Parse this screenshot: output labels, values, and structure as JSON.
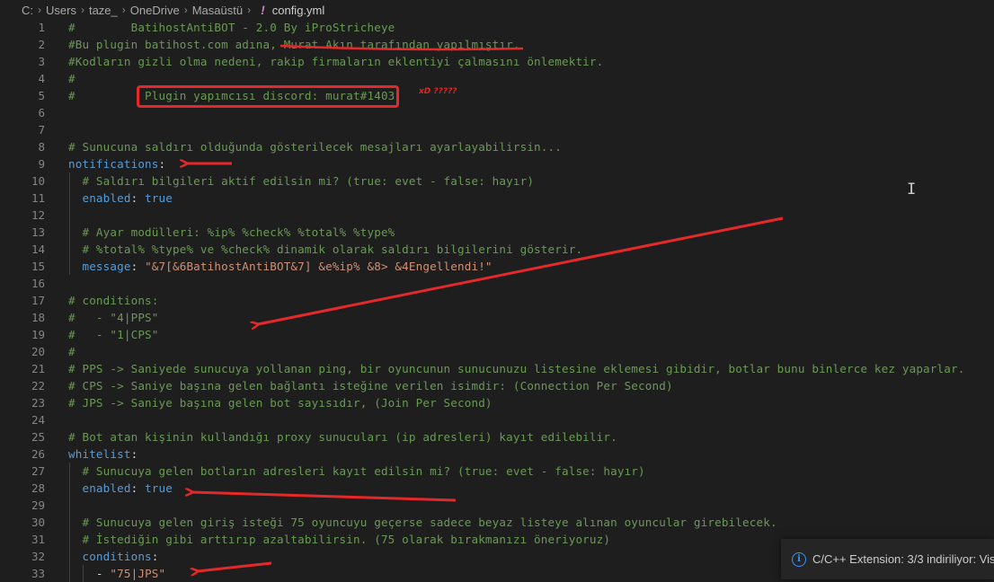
{
  "breadcrumb": {
    "items": [
      "C:",
      "Users",
      "taze_",
      "OneDrive",
      "Masaüstü"
    ],
    "file_icon": "!",
    "file": "config.yml"
  },
  "editor": {
    "lines": [
      {
        "n": "1",
        "t": [
          [
            "c",
            "#        BatihostAntiBOT - 2.0 By iProStricheye"
          ]
        ]
      },
      {
        "n": "2",
        "t": [
          [
            "c",
            "#Bu plugin batihost.com adına, Murat Akın tarafından yapılmıştır."
          ]
        ]
      },
      {
        "n": "3",
        "t": [
          [
            "c",
            "#Kodların gizli olma nedeni, rakip firmaların eklentiyi çalmasını önlemektir."
          ]
        ]
      },
      {
        "n": "4",
        "t": [
          [
            "c",
            "#"
          ]
        ]
      },
      {
        "n": "5",
        "t": [
          [
            "c",
            "#          Plugin yapımcısı discord: murat#1403"
          ]
        ]
      },
      {
        "n": "6",
        "t": []
      },
      {
        "n": "7",
        "t": []
      },
      {
        "n": "8",
        "t": [
          [
            "c",
            "# Sunucuna saldırı olduğunda gösterilecek mesajları ayarlayabilirsin..."
          ]
        ]
      },
      {
        "n": "9",
        "t": [
          [
            "k",
            "notifications"
          ],
          [
            "p",
            ":"
          ]
        ]
      },
      {
        "n": "10",
        "t": [
          [
            "p",
            "  "
          ],
          [
            "c",
            "# Saldırı bilgileri aktif edilsin mi? (true: evet - false: hayır)"
          ]
        ]
      },
      {
        "n": "11",
        "t": [
          [
            "p",
            "  "
          ],
          [
            "k",
            "enabled"
          ],
          [
            "p",
            ": "
          ],
          [
            "b",
            "true"
          ]
        ]
      },
      {
        "n": "12",
        "t": []
      },
      {
        "n": "13",
        "t": [
          [
            "p",
            "  "
          ],
          [
            "c",
            "# Ayar modülleri: %ip% %check% %total% %type%"
          ]
        ]
      },
      {
        "n": "14",
        "t": [
          [
            "p",
            "  "
          ],
          [
            "c",
            "# %total% %type% ve %check% dinamik olarak saldırı bilgilerini gösterir."
          ]
        ]
      },
      {
        "n": "15",
        "t": [
          [
            "p",
            "  "
          ],
          [
            "k",
            "message"
          ],
          [
            "p",
            ": "
          ],
          [
            "s",
            "\"&7[&6BatihostAntiBOT&7] &e%ip% &8> &4Engellendi!\""
          ]
        ]
      },
      {
        "n": "16",
        "t": []
      },
      {
        "n": "17",
        "t": [
          [
            "c",
            "# conditions:"
          ]
        ]
      },
      {
        "n": "18",
        "t": [
          [
            "c",
            "#   - \"4|PPS\""
          ]
        ]
      },
      {
        "n": "19",
        "t": [
          [
            "c",
            "#   - \"1|CPS\""
          ]
        ]
      },
      {
        "n": "20",
        "t": [
          [
            "c",
            "#"
          ]
        ]
      },
      {
        "n": "21",
        "t": [
          [
            "c",
            "# PPS -> Saniyede sunucuya yollanan ping, bir oyuncunun sunucunuzu listesine eklemesi gibidir, botlar bunu binlerce kez yaparlar."
          ]
        ]
      },
      {
        "n": "22",
        "t": [
          [
            "c",
            "# CPS -> Saniye başına gelen bağlantı isteğine verilen isimdir: (Connection Per Second)"
          ]
        ]
      },
      {
        "n": "23",
        "t": [
          [
            "c",
            "# JPS -> Saniye başına gelen bot sayısıdır, (Join Per Second)"
          ]
        ]
      },
      {
        "n": "24",
        "t": []
      },
      {
        "n": "25",
        "t": [
          [
            "c",
            "# Bot atan kişinin kullandığı proxy sunucuları (ip adresleri) kayıt edilebilir."
          ]
        ]
      },
      {
        "n": "26",
        "t": [
          [
            "k",
            "whitelist"
          ],
          [
            "p",
            ":"
          ]
        ]
      },
      {
        "n": "27",
        "t": [
          [
            "p",
            "  "
          ],
          [
            "c",
            "# Sunucuya gelen botların adresleri kayıt edilsin mi? (true: evet - false: hayır)"
          ]
        ]
      },
      {
        "n": "28",
        "t": [
          [
            "p",
            "  "
          ],
          [
            "k",
            "enabled"
          ],
          [
            "p",
            ": "
          ],
          [
            "b",
            "true"
          ]
        ]
      },
      {
        "n": "29",
        "t": []
      },
      {
        "n": "30",
        "t": [
          [
            "p",
            "  "
          ],
          [
            "c",
            "# Sunucuya gelen giriş isteği 75 oyuncuyu geçerse sadece beyaz listeye alınan oyuncular girebilecek."
          ]
        ]
      },
      {
        "n": "31",
        "t": [
          [
            "p",
            "  "
          ],
          [
            "c",
            "# İstediğin gibi arttırıp azaltabilirsin. (75 olarak bırakmanızı öneriyoruz)"
          ]
        ]
      },
      {
        "n": "32",
        "t": [
          [
            "p",
            "  "
          ],
          [
            "k",
            "conditions"
          ],
          [
            "p",
            ":"
          ]
        ]
      },
      {
        "n": "33",
        "t": [
          [
            "p",
            "    - "
          ],
          [
            "s",
            "\"75|JPS\""
          ]
        ]
      }
    ]
  },
  "annotations": {
    "note": "xD ?????"
  },
  "toast": {
    "message": "C/C++ Extension: 3/3 indiriliyor: Vis"
  },
  "colors": {
    "background": "#1e1e1e",
    "comment": "#6a9955",
    "key": "#569cd6",
    "string": "#ce9178",
    "annotation_red": "#e5292b"
  }
}
